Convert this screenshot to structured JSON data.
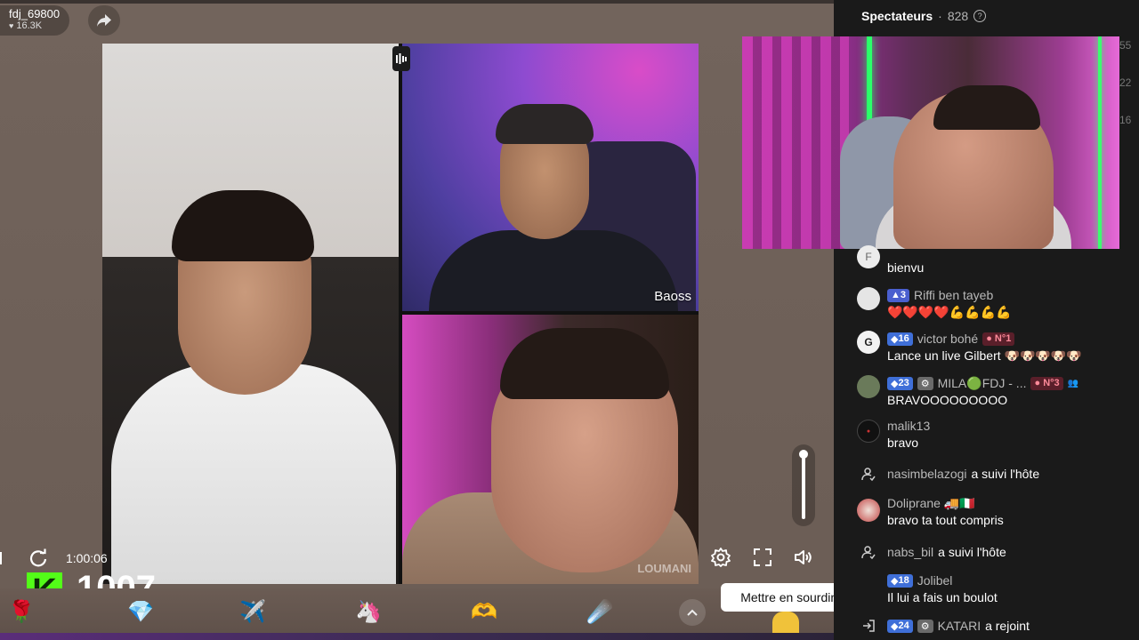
{
  "stream": {
    "host_name": "fdj_69800",
    "host_likes": "16.3K",
    "timer": "1:00:06",
    "kick_count": "1007",
    "kick_logo_letter": "K",
    "participant_name_top_right": "Baoss",
    "participant_watermark_bottom_right": "LOUMANI",
    "tooltip": "Mettre en sourdine (M)",
    "colors": {
      "kick_green": "#53fc18",
      "chat_bg": "#1a1a1a",
      "stage_bg": "#6f6159"
    }
  },
  "chat": {
    "header_title": "Spectateurs",
    "header_sep": "·",
    "viewer_count": "828",
    "edge_numbers": [
      "55",
      "22",
      "16"
    ],
    "messages": [
      {
        "user": "",
        "avatar_letter": "F",
        "text": "bienvu"
      },
      {
        "badge_level": "3",
        "user": "Riffi ben tayeb",
        "text": "❤️❤️❤️❤️💪💪💪💪"
      },
      {
        "badge_level": "16",
        "user": "victor bohé",
        "rank": "N°1",
        "text": "Lance un live Gilbert 🐶🐶🐶🐶🐶"
      },
      {
        "badge_level": "23",
        "user": "MILA🟢FDJ - ...",
        "rank": "N°3",
        "text": "BRAVOOOOOOOOO"
      },
      {
        "user": "malik13",
        "text": "bravo"
      },
      {
        "user": "nasimbelazogi",
        "system_text": "a suivi l'hôte"
      },
      {
        "user": "Doliprane 🚚🇮🇹",
        "text": "bravo ta tout compris"
      },
      {
        "user": "nabs_bil",
        "system_text": "a suivi l'hôte"
      },
      {
        "badge_level": "18",
        "user": "Jolibel",
        "text": "Il lui a fais un boulot"
      },
      {
        "badge_level": "24",
        "user": "KATARI",
        "system_text": "a rejoint"
      }
    ]
  }
}
